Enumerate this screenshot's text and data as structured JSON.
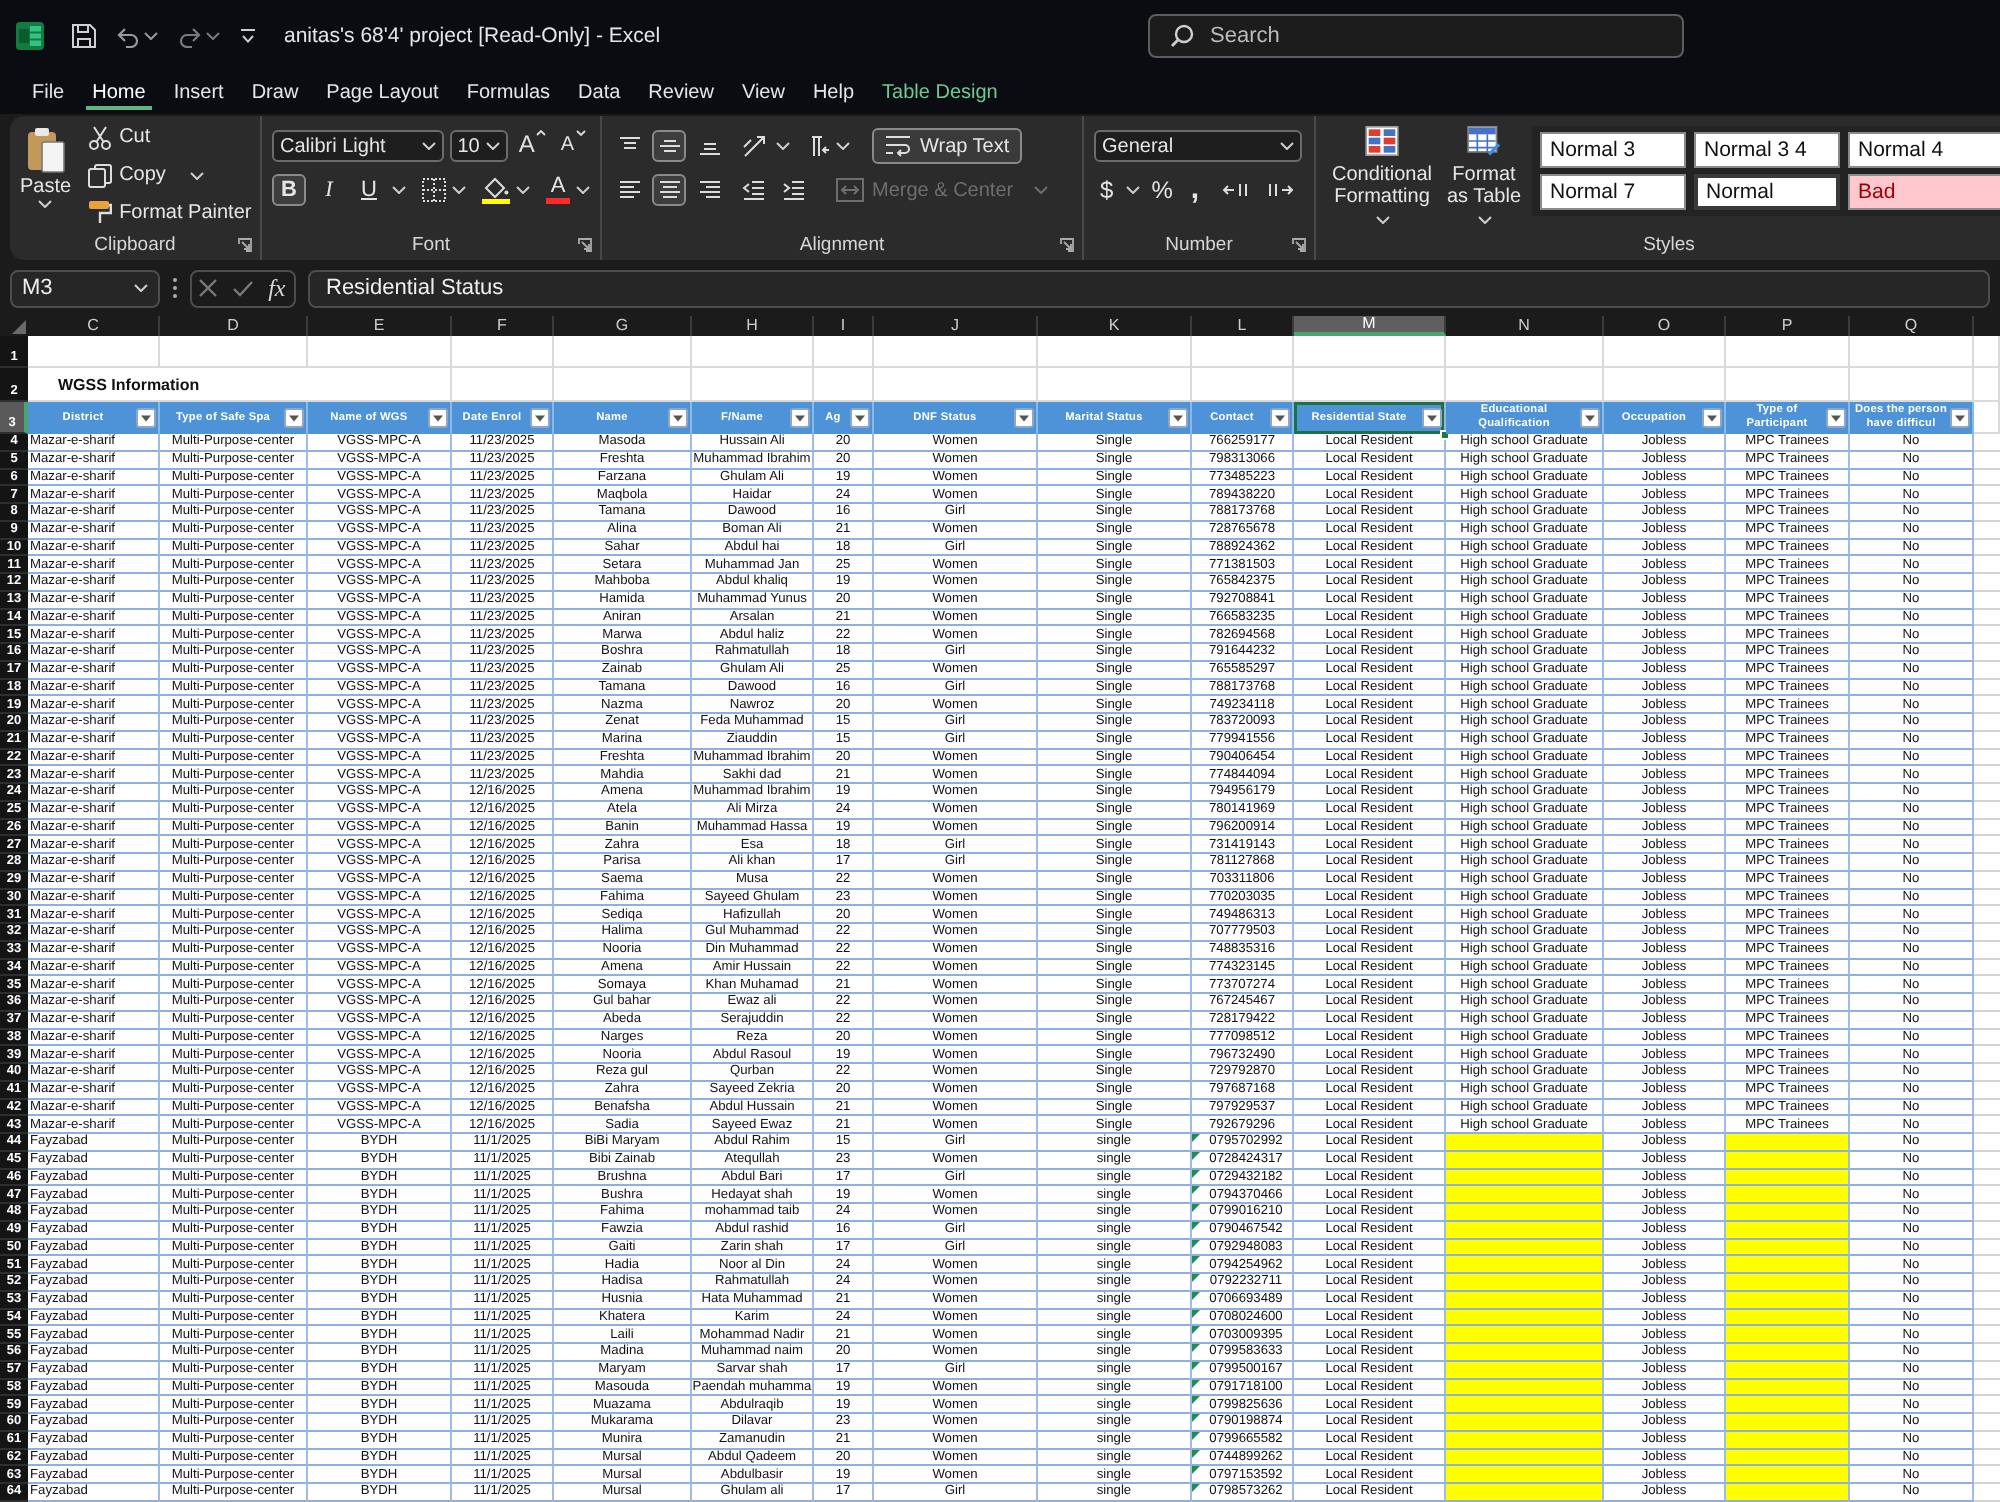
{
  "titlebar": {
    "title": "anitas's 68'4' project [Read-Only] - Excel",
    "search": {
      "placeholder": "Search"
    }
  },
  "menu_tabs": [
    {
      "label": "File",
      "selected": false,
      "kind": "standard"
    },
    {
      "label": "Home",
      "selected": true,
      "kind": "standard"
    },
    {
      "label": "Insert",
      "selected": false,
      "kind": "standard"
    },
    {
      "label": "Draw",
      "selected": false,
      "kind": "standard"
    },
    {
      "label": "Page Layout",
      "selected": false,
      "kind": "standard"
    },
    {
      "label": "Formulas",
      "selected": false,
      "kind": "standard"
    },
    {
      "label": "Data",
      "selected": false,
      "kind": "standard"
    },
    {
      "label": "Review",
      "selected": false,
      "kind": "standard"
    },
    {
      "label": "View",
      "selected": false,
      "kind": "standard"
    },
    {
      "label": "Help",
      "selected": false,
      "kind": "standard"
    },
    {
      "label": "Table Design",
      "selected": false,
      "kind": "contextual"
    }
  ],
  "ribbon": {
    "clipboard": {
      "label": "Clipboard",
      "paste": "Paste",
      "cut": "Cut",
      "copy": "Copy",
      "format_painter": "Format Painter"
    },
    "font": {
      "label": "Font",
      "font_name": "Calibri Light",
      "font_size": "10",
      "grow_font": "A",
      "shrink_font": "A",
      "bold": {
        "label": "B",
        "on": true
      },
      "italic": {
        "label": "I",
        "on": false
      },
      "underline": {
        "label": "U",
        "on": false
      },
      "font_color": "A"
    },
    "alignment": {
      "label": "Alignment",
      "vertical": [
        {
          "selected": false
        },
        {
          "selected": true
        },
        {
          "selected": false
        }
      ],
      "horizontal": [
        {
          "selected": false
        },
        {
          "selected": true
        },
        {
          "selected": false
        }
      ],
      "wrap_text": {
        "label": "Wrap Text",
        "on": true
      },
      "merge_center": {
        "label": "Merge & Center",
        "disabled": true
      }
    },
    "number": {
      "label": "Number",
      "format": "General",
      "currency": "$",
      "percent": "%",
      "comma": ","
    },
    "styles": {
      "label": "Styles",
      "conditional_formatting": "Conditional Formatting",
      "format_as_table": "Format as Table",
      "cell_styles": [
        {
          "label": "Normal 3",
          "kind": "normal",
          "selected": false
        },
        {
          "label": "Normal 3 4",
          "kind": "normal",
          "selected": false
        },
        {
          "label": "Normal 4",
          "kind": "normal",
          "selected": false
        },
        {
          "label": "Normal 7",
          "kind": "normal",
          "selected": false
        },
        {
          "label": "Normal",
          "kind": "normal",
          "selected": true
        },
        {
          "label": "Bad",
          "kind": "bad",
          "selected": false
        }
      ]
    }
  },
  "formula_bar": {
    "name_box": "M3",
    "function_button": "fx",
    "content": "Residential Status"
  },
  "sheet": {
    "columns": [
      {
        "letter": "C",
        "selected": false
      },
      {
        "letter": "D",
        "selected": false
      },
      {
        "letter": "E",
        "selected": false
      },
      {
        "letter": "F",
        "selected": false
      },
      {
        "letter": "G",
        "selected": false
      },
      {
        "letter": "H",
        "selected": false
      },
      {
        "letter": "I",
        "selected": false
      },
      {
        "letter": "J",
        "selected": false
      },
      {
        "letter": "K",
        "selected": false
      },
      {
        "letter": "L",
        "selected": false
      },
      {
        "letter": "M",
        "selected": true
      },
      {
        "letter": "N",
        "selected": false
      },
      {
        "letter": "O",
        "selected": false
      },
      {
        "letter": "P",
        "selected": false
      },
      {
        "letter": "Q",
        "selected": false
      }
    ],
    "first_row": {
      "number": "1",
      "selected": false
    },
    "title_row": {
      "number": "2",
      "selected": false,
      "title": "WGSS Information"
    },
    "header_row": {
      "number": "3",
      "selected": true,
      "cells": [
        "District",
        "Type of Safe Spa",
        "Name of WGS",
        "Date Enrol",
        "Name",
        "F/Name",
        "Ag",
        "DNF Status",
        "Marital Status",
        "Contact",
        "Residential State",
        "Educational Qualification",
        "Occupation",
        "Type of Participant",
        "Does the person have difficul"
      ]
    },
    "rows": [
      {
        "number": "4",
        "selected": false,
        "number_stored_as_text": false,
        "cells": [
          "Mazar-e-sharif",
          "Multi-Purpose-center",
          "VGSS-MPC-A",
          "11/23/2025",
          "Masoda",
          "Hussain Ali",
          "20",
          "Women",
          "Single",
          "766259177",
          "Local Resident",
          "High school Graduate",
          "Jobless",
          "MPC Trainees",
          "No"
        ]
      },
      {
        "number": "5",
        "selected": false,
        "number_stored_as_text": false,
        "cells": [
          "Mazar-e-sharif",
          "Multi-Purpose-center",
          "VGSS-MPC-A",
          "11/23/2025",
          "Freshta",
          "Muhammad Ibrahim",
          "20",
          "Women",
          "Single",
          "798313066",
          "Local Resident",
          "High school Graduate",
          "Jobless",
          "MPC Trainees",
          "No"
        ]
      },
      {
        "number": "6",
        "selected": false,
        "number_stored_as_text": false,
        "cells": [
          "Mazar-e-sharif",
          "Multi-Purpose-center",
          "VGSS-MPC-A",
          "11/23/2025",
          "Farzana",
          "Ghulam Ali",
          "19",
          "Women",
          "Single",
          "773485223",
          "Local Resident",
          "High school Graduate",
          "Jobless",
          "MPC Trainees",
          "No"
        ]
      },
      {
        "number": "7",
        "selected": false,
        "number_stored_as_text": false,
        "cells": [
          "Mazar-e-sharif",
          "Multi-Purpose-center",
          "VGSS-MPC-A",
          "11/23/2025",
          "Maqbola",
          "Haidar",
          "24",
          "Women",
          "Single",
          "789438220",
          "Local Resident",
          "High school Graduate",
          "Jobless",
          "MPC Trainees",
          "No"
        ]
      },
      {
        "number": "8",
        "selected": false,
        "number_stored_as_text": false,
        "cells": [
          "Mazar-e-sharif",
          "Multi-Purpose-center",
          "VGSS-MPC-A",
          "11/23/2025",
          "Tamana",
          "Dawood",
          "16",
          "Girl",
          "Single",
          "788173768",
          "Local Resident",
          "High school Graduate",
          "Jobless",
          "MPC Trainees",
          "No"
        ]
      },
      {
        "number": "9",
        "selected": false,
        "number_stored_as_text": false,
        "cells": [
          "Mazar-e-sharif",
          "Multi-Purpose-center",
          "VGSS-MPC-A",
          "11/23/2025",
          "Alina",
          "Boman Ali",
          "21",
          "Women",
          "Single",
          "728765678",
          "Local Resident",
          "High school Graduate",
          "Jobless",
          "MPC Trainees",
          "No"
        ]
      },
      {
        "number": "10",
        "selected": false,
        "number_stored_as_text": false,
        "cells": [
          "Mazar-e-sharif",
          "Multi-Purpose-center",
          "VGSS-MPC-A",
          "11/23/2025",
          "Sahar",
          "Abdul hai",
          "18",
          "Girl",
          "Single",
          "788924362",
          "Local Resident",
          "High school Graduate",
          "Jobless",
          "MPC Trainees",
          "No"
        ]
      },
      {
        "number": "11",
        "selected": false,
        "number_stored_as_text": false,
        "cells": [
          "Mazar-e-sharif",
          "Multi-Purpose-center",
          "VGSS-MPC-A",
          "11/23/2025",
          "Setara",
          "Muhammad Jan",
          "25",
          "Women",
          "Single",
          "771381503",
          "Local Resident",
          "High school Graduate",
          "Jobless",
          "MPC Trainees",
          "No"
        ]
      },
      {
        "number": "12",
        "selected": false,
        "number_stored_as_text": false,
        "cells": [
          "Mazar-e-sharif",
          "Multi-Purpose-center",
          "VGSS-MPC-A",
          "11/23/2025",
          "Mahboba",
          "Abdul khaliq",
          "19",
          "Women",
          "Single",
          "765842375",
          "Local Resident",
          "High school Graduate",
          "Jobless",
          "MPC Trainees",
          "No"
        ]
      },
      {
        "number": "13",
        "selected": false,
        "number_stored_as_text": false,
        "cells": [
          "Mazar-e-sharif",
          "Multi-Purpose-center",
          "VGSS-MPC-A",
          "11/23/2025",
          "Hamida",
          "Muhammad Yunus",
          "20",
          "Women",
          "Single",
          "792708841",
          "Local Resident",
          "High school Graduate",
          "Jobless",
          "MPC Trainees",
          "No"
        ]
      },
      {
        "number": "14",
        "selected": false,
        "number_stored_as_text": false,
        "cells": [
          "Mazar-e-sharif",
          "Multi-Purpose-center",
          "VGSS-MPC-A",
          "11/23/2025",
          "Aniran",
          "Arsalan",
          "21",
          "Women",
          "Single",
          "766583235",
          "Local Resident",
          "High school Graduate",
          "Jobless",
          "MPC Trainees",
          "No"
        ]
      },
      {
        "number": "15",
        "selected": false,
        "number_stored_as_text": false,
        "cells": [
          "Mazar-e-sharif",
          "Multi-Purpose-center",
          "VGSS-MPC-A",
          "11/23/2025",
          "Marwa",
          "Abdul haliz",
          "22",
          "Women",
          "Single",
          "782694568",
          "Local Resident",
          "High school Graduate",
          "Jobless",
          "MPC Trainees",
          "No"
        ]
      },
      {
        "number": "16",
        "selected": false,
        "number_stored_as_text": false,
        "cells": [
          "Mazar-e-sharif",
          "Multi-Purpose-center",
          "VGSS-MPC-A",
          "11/23/2025",
          "Boshra",
          "Rahmatullah",
          "18",
          "Girl",
          "Single",
          "791644232",
          "Local Resident",
          "High school Graduate",
          "Jobless",
          "MPC Trainees",
          "No"
        ]
      },
      {
        "number": "17",
        "selected": false,
        "number_stored_as_text": false,
        "cells": [
          "Mazar-e-sharif",
          "Multi-Purpose-center",
          "VGSS-MPC-A",
          "11/23/2025",
          "Zainab",
          "Ghulam Ali",
          "25",
          "Women",
          "Single",
          "765585297",
          "Local Resident",
          "High school Graduate",
          "Jobless",
          "MPC Trainees",
          "No"
        ]
      },
      {
        "number": "18",
        "selected": false,
        "number_stored_as_text": false,
        "cells": [
          "Mazar-e-sharif",
          "Multi-Purpose-center",
          "VGSS-MPC-A",
          "11/23/2025",
          "Tamana",
          "Dawood",
          "16",
          "Girl",
          "Single",
          "788173768",
          "Local Resident",
          "High school Graduate",
          "Jobless",
          "MPC Trainees",
          "No"
        ]
      },
      {
        "number": "19",
        "selected": false,
        "number_stored_as_text": false,
        "cells": [
          "Mazar-e-sharif",
          "Multi-Purpose-center",
          "VGSS-MPC-A",
          "11/23/2025",
          "Nazma",
          "Nawroz",
          "20",
          "Women",
          "Single",
          "749234118",
          "Local Resident",
          "High school Graduate",
          "Jobless",
          "MPC Trainees",
          "No"
        ]
      },
      {
        "number": "20",
        "selected": false,
        "number_stored_as_text": false,
        "cells": [
          "Mazar-e-sharif",
          "Multi-Purpose-center",
          "VGSS-MPC-A",
          "11/23/2025",
          "Zenat",
          "Feda Muhammad",
          "15",
          "Girl",
          "Single",
          "783720093",
          "Local Resident",
          "High school Graduate",
          "Jobless",
          "MPC Trainees",
          "No"
        ]
      },
      {
        "number": "21",
        "selected": false,
        "number_stored_as_text": false,
        "cells": [
          "Mazar-e-sharif",
          "Multi-Purpose-center",
          "VGSS-MPC-A",
          "11/23/2025",
          "Marina",
          "Ziauddin",
          "15",
          "Girl",
          "Single",
          "779941556",
          "Local Resident",
          "High school Graduate",
          "Jobless",
          "MPC Trainees",
          "No"
        ]
      },
      {
        "number": "22",
        "selected": false,
        "number_stored_as_text": false,
        "cells": [
          "Mazar-e-sharif",
          "Multi-Purpose-center",
          "VGSS-MPC-A",
          "11/23/2025",
          "Freshta",
          "Muhammad Ibrahim",
          "20",
          "Women",
          "Single",
          "790406454",
          "Local Resident",
          "High school Graduate",
          "Jobless",
          "MPC Trainees",
          "No"
        ]
      },
      {
        "number": "23",
        "selected": false,
        "number_stored_as_text": false,
        "cells": [
          "Mazar-e-sharif",
          "Multi-Purpose-center",
          "VGSS-MPC-A",
          "11/23/2025",
          "Mahdia",
          "Sakhi dad",
          "21",
          "Women",
          "Single",
          "774844094",
          "Local Resident",
          "High school Graduate",
          "Jobless",
          "MPC Trainees",
          "No"
        ]
      },
      {
        "number": "24",
        "selected": false,
        "number_stored_as_text": false,
        "cells": [
          "Mazar-e-sharif",
          "Multi-Purpose-center",
          "VGSS-MPC-A",
          "12/16/2025",
          "Amena",
          "Muhammad Ibrahim",
          "19",
          "Women",
          "Single",
          "794956179",
          "Local Resident",
          "High school Graduate",
          "Jobless",
          "MPC Trainees",
          "No"
        ]
      },
      {
        "number": "25",
        "selected": false,
        "number_stored_as_text": false,
        "cells": [
          "Mazar-e-sharif",
          "Multi-Purpose-center",
          "VGSS-MPC-A",
          "12/16/2025",
          "Atela",
          "Ali Mirza",
          "24",
          "Women",
          "Single",
          "780141969",
          "Local Resident",
          "High school Graduate",
          "Jobless",
          "MPC Trainees",
          "No"
        ]
      },
      {
        "number": "26",
        "selected": false,
        "number_stored_as_text": false,
        "cells": [
          "Mazar-e-sharif",
          "Multi-Purpose-center",
          "VGSS-MPC-A",
          "12/16/2025",
          "Banin",
          "Muhammad Hassa",
          "19",
          "Women",
          "Single",
          "796200914",
          "Local Resident",
          "High school Graduate",
          "Jobless",
          "MPC Trainees",
          "No"
        ]
      },
      {
        "number": "27",
        "selected": false,
        "number_stored_as_text": false,
        "cells": [
          "Mazar-e-sharif",
          "Multi-Purpose-center",
          "VGSS-MPC-A",
          "12/16/2025",
          "Zahra",
          "Esa",
          "18",
          "Girl",
          "Single",
          "731419143",
          "Local Resident",
          "High school Graduate",
          "Jobless",
          "MPC Trainees",
          "No"
        ]
      },
      {
        "number": "28",
        "selected": false,
        "number_stored_as_text": false,
        "cells": [
          "Mazar-e-sharif",
          "Multi-Purpose-center",
          "VGSS-MPC-A",
          "12/16/2025",
          "Parisa",
          "Ali khan",
          "17",
          "Girl",
          "Single",
          "781127868",
          "Local Resident",
          "High school Graduate",
          "Jobless",
          "MPC Trainees",
          "No"
        ]
      },
      {
        "number": "29",
        "selected": false,
        "number_stored_as_text": false,
        "cells": [
          "Mazar-e-sharif",
          "Multi-Purpose-center",
          "VGSS-MPC-A",
          "12/16/2025",
          "Saema",
          "Musa",
          "22",
          "Women",
          "Single",
          "703311806",
          "Local Resident",
          "High school Graduate",
          "Jobless",
          "MPC Trainees",
          "No"
        ]
      },
      {
        "number": "30",
        "selected": false,
        "number_stored_as_text": false,
        "cells": [
          "Mazar-e-sharif",
          "Multi-Purpose-center",
          "VGSS-MPC-A",
          "12/16/2025",
          "Fahima",
          "Sayeed Ghulam",
          "23",
          "Women",
          "Single",
          "770203035",
          "Local Resident",
          "High school Graduate",
          "Jobless",
          "MPC Trainees",
          "No"
        ]
      },
      {
        "number": "31",
        "selected": false,
        "number_stored_as_text": false,
        "cells": [
          "Mazar-e-sharif",
          "Multi-Purpose-center",
          "VGSS-MPC-A",
          "12/16/2025",
          "Sediqa",
          "Hafizullah",
          "20",
          "Women",
          "Single",
          "749486313",
          "Local Resident",
          "High school Graduate",
          "Jobless",
          "MPC Trainees",
          "No"
        ]
      },
      {
        "number": "32",
        "selected": false,
        "number_stored_as_text": false,
        "cells": [
          "Mazar-e-sharif",
          "Multi-Purpose-center",
          "VGSS-MPC-A",
          "12/16/2025",
          "Halima",
          "Gul Muhammad",
          "22",
          "Women",
          "Single",
          "707779503",
          "Local Resident",
          "High school Graduate",
          "Jobless",
          "MPC Trainees",
          "No"
        ]
      },
      {
        "number": "33",
        "selected": false,
        "number_stored_as_text": false,
        "cells": [
          "Mazar-e-sharif",
          "Multi-Purpose-center",
          "VGSS-MPC-A",
          "12/16/2025",
          "Nooria",
          "Din Muhammad",
          "22",
          "Women",
          "Single",
          "748835316",
          "Local Resident",
          "High school Graduate",
          "Jobless",
          "MPC Trainees",
          "No"
        ]
      },
      {
        "number": "34",
        "selected": false,
        "number_stored_as_text": false,
        "cells": [
          "Mazar-e-sharif",
          "Multi-Purpose-center",
          "VGSS-MPC-A",
          "12/16/2025",
          "Amena",
          "Amir Hussain",
          "22",
          "Women",
          "Single",
          "774323145",
          "Local Resident",
          "High school Graduate",
          "Jobless",
          "MPC Trainees",
          "No"
        ]
      },
      {
        "number": "35",
        "selected": false,
        "number_stored_as_text": false,
        "cells": [
          "Mazar-e-sharif",
          "Multi-Purpose-center",
          "VGSS-MPC-A",
          "12/16/2025",
          "Somaya",
          "Khan Muhamad",
          "21",
          "Women",
          "Single",
          "773707274",
          "Local Resident",
          "High school Graduate",
          "Jobless",
          "MPC Trainees",
          "No"
        ]
      },
      {
        "number": "36",
        "selected": false,
        "number_stored_as_text": false,
        "cells": [
          "Mazar-e-sharif",
          "Multi-Purpose-center",
          "VGSS-MPC-A",
          "12/16/2025",
          "Gul bahar",
          "Ewaz ali",
          "22",
          "Women",
          "Single",
          "767245467",
          "Local Resident",
          "High school Graduate",
          "Jobless",
          "MPC Trainees",
          "No"
        ]
      },
      {
        "number": "37",
        "selected": false,
        "number_stored_as_text": false,
        "cells": [
          "Mazar-e-sharif",
          "Multi-Purpose-center",
          "VGSS-MPC-A",
          "12/16/2025",
          "Abeda",
          "Serajuddin",
          "22",
          "Women",
          "Single",
          "728179422",
          "Local Resident",
          "High school Graduate",
          "Jobless",
          "MPC Trainees",
          "No"
        ]
      },
      {
        "number": "38",
        "selected": false,
        "number_stored_as_text": false,
        "cells": [
          "Mazar-e-sharif",
          "Multi-Purpose-center",
          "VGSS-MPC-A",
          "12/16/2025",
          "Narges",
          "Reza",
          "20",
          "Women",
          "Single",
          "777098512",
          "Local Resident",
          "High school Graduate",
          "Jobless",
          "MPC Trainees",
          "No"
        ]
      },
      {
        "number": "39",
        "selected": false,
        "number_stored_as_text": false,
        "cells": [
          "Mazar-e-sharif",
          "Multi-Purpose-center",
          "VGSS-MPC-A",
          "12/16/2025",
          "Nooria",
          "Abdul Rasoul",
          "19",
          "Women",
          "Single",
          "796732490",
          "Local Resident",
          "High school Graduate",
          "Jobless",
          "MPC Trainees",
          "No"
        ]
      },
      {
        "number": "40",
        "selected": false,
        "number_stored_as_text": false,
        "cells": [
          "Mazar-e-sharif",
          "Multi-Purpose-center",
          "VGSS-MPC-A",
          "12/16/2025",
          "Reza gul",
          "Qurban",
          "22",
          "Women",
          "Single",
          "729792870",
          "Local Resident",
          "High school Graduate",
          "Jobless",
          "MPC Trainees",
          "No"
        ]
      },
      {
        "number": "41",
        "selected": false,
        "number_stored_as_text": false,
        "cells": [
          "Mazar-e-sharif",
          "Multi-Purpose-center",
          "VGSS-MPC-A",
          "12/16/2025",
          "Zahra",
          "Sayeed Zekria",
          "20",
          "Women",
          "Single",
          "797687168",
          "Local Resident",
          "High school Graduate",
          "Jobless",
          "MPC Trainees",
          "No"
        ]
      },
      {
        "number": "42",
        "selected": false,
        "number_stored_as_text": false,
        "cells": [
          "Mazar-e-sharif",
          "Multi-Purpose-center",
          "VGSS-MPC-A",
          "12/16/2025",
          "Benafsha",
          "Abdul Hussain",
          "21",
          "Women",
          "Single",
          "797929537",
          "Local Resident",
          "High school Graduate",
          "Jobless",
          "MPC Trainees",
          "No"
        ]
      },
      {
        "number": "43",
        "selected": false,
        "number_stored_as_text": false,
        "cells": [
          "Mazar-e-sharif",
          "Multi-Purpose-center",
          "VGSS-MPC-A",
          "12/16/2025",
          "Sadia",
          "Sayeed Ewaz",
          "21",
          "Women",
          "Single",
          "792679296",
          "Local Resident",
          "High school Graduate",
          "Jobless",
          "MPC Trainees",
          "No"
        ]
      },
      {
        "number": "44",
        "selected": false,
        "number_stored_as_text": true,
        "cells": [
          "Fayzabad",
          "Multi-Purpose-center",
          "BYDH",
          "11/1/2025",
          "BiBi Maryam",
          "Abdul Rahim",
          "15",
          "Girl",
          "single",
          "0795702992",
          "Local Resident",
          {
            "highlight": true
          },
          "Jobless",
          {
            "highlight": true
          },
          "No"
        ]
      },
      {
        "number": "45",
        "selected": false,
        "number_stored_as_text": true,
        "cells": [
          "Fayzabad",
          "Multi-Purpose-center",
          "BYDH",
          "11/1/2025",
          "Bibi Zainab",
          "Atequllah",
          "23",
          "Women",
          "single",
          "0728424317",
          "Local Resident",
          {
            "highlight": true
          },
          "Jobless",
          {
            "highlight": true
          },
          "No"
        ]
      },
      {
        "number": "46",
        "selected": false,
        "number_stored_as_text": true,
        "cells": [
          "Fayzabad",
          "Multi-Purpose-center",
          "BYDH",
          "11/1/2025",
          "Brushna",
          "Abdul Bari",
          "17",
          "Girl",
          "single",
          "0729432182",
          "Local Resident",
          {
            "highlight": true
          },
          "Jobless",
          {
            "highlight": true
          },
          "No"
        ]
      },
      {
        "number": "47",
        "selected": false,
        "number_stored_as_text": true,
        "cells": [
          "Fayzabad",
          "Multi-Purpose-center",
          "BYDH",
          "11/1/2025",
          "Bushra",
          "Hedayat shah",
          "19",
          "Women",
          "single",
          "0794370466",
          "Local Resident",
          {
            "highlight": true
          },
          "Jobless",
          {
            "highlight": true
          },
          "No"
        ]
      },
      {
        "number": "48",
        "selected": false,
        "number_stored_as_text": true,
        "cells": [
          "Fayzabad",
          "Multi-Purpose-center",
          "BYDH",
          "11/1/2025",
          "Fahima",
          "mohammad taib",
          "24",
          "Women",
          "single",
          "0799016210",
          "Local Resident",
          {
            "highlight": true
          },
          "Jobless",
          {
            "highlight": true
          },
          "No"
        ]
      },
      {
        "number": "49",
        "selected": false,
        "number_stored_as_text": true,
        "cells": [
          "Fayzabad",
          "Multi-Purpose-center",
          "BYDH",
          "11/1/2025",
          "Fawzia",
          "Abdul rashid",
          "16",
          "Girl",
          "single",
          "0790467542",
          "Local Resident",
          {
            "highlight": true
          },
          "Jobless",
          {
            "highlight": true
          },
          "No"
        ]
      },
      {
        "number": "50",
        "selected": false,
        "number_stored_as_text": true,
        "cells": [
          "Fayzabad",
          "Multi-Purpose-center",
          "BYDH",
          "11/1/2025",
          "Gaiti",
          "Zarin shah",
          "17",
          "Girl",
          "single",
          "0792948083",
          "Local Resident",
          {
            "highlight": true
          },
          "Jobless",
          {
            "highlight": true
          },
          "No"
        ]
      },
      {
        "number": "51",
        "selected": false,
        "number_stored_as_text": true,
        "cells": [
          "Fayzabad",
          "Multi-Purpose-center",
          "BYDH",
          "11/1/2025",
          "Hadia",
          "Noor al Din",
          "24",
          "Women",
          "single",
          "0794254962",
          "Local Resident",
          {
            "highlight": true
          },
          "Jobless",
          {
            "highlight": true
          },
          "No"
        ]
      },
      {
        "number": "52",
        "selected": false,
        "number_stored_as_text": true,
        "cells": [
          "Fayzabad",
          "Multi-Purpose-center",
          "BYDH",
          "11/1/2025",
          "Hadisa",
          "Rahmatullah",
          "24",
          "Women",
          "single",
          "0792232711",
          "Local Resident",
          {
            "highlight": true
          },
          "Jobless",
          {
            "highlight": true
          },
          "No"
        ]
      },
      {
        "number": "53",
        "selected": false,
        "number_stored_as_text": true,
        "cells": [
          "Fayzabad",
          "Multi-Purpose-center",
          "BYDH",
          "11/1/2025",
          "Husnia",
          "Hata Muhammad",
          "21",
          "Women",
          "single",
          "0706693489",
          "Local Resident",
          {
            "highlight": true
          },
          "Jobless",
          {
            "highlight": true
          },
          "No"
        ]
      },
      {
        "number": "54",
        "selected": false,
        "number_stored_as_text": true,
        "cells": [
          "Fayzabad",
          "Multi-Purpose-center",
          "BYDH",
          "11/1/2025",
          "Khatera",
          "Karim",
          "24",
          "Women",
          "single",
          "0708024600",
          "Local Resident",
          {
            "highlight": true
          },
          "Jobless",
          {
            "highlight": true
          },
          "No"
        ]
      },
      {
        "number": "55",
        "selected": false,
        "number_stored_as_text": true,
        "cells": [
          "Fayzabad",
          "Multi-Purpose-center",
          "BYDH",
          "11/1/2025",
          "Laili",
          "Mohammad Nadir",
          "21",
          "Women",
          "single",
          "0703009395",
          "Local Resident",
          {
            "highlight": true
          },
          "Jobless",
          {
            "highlight": true
          },
          "No"
        ]
      },
      {
        "number": "56",
        "selected": false,
        "number_stored_as_text": true,
        "cells": [
          "Fayzabad",
          "Multi-Purpose-center",
          "BYDH",
          "11/1/2025",
          "Madina",
          "Muhammad naim",
          "20",
          "Women",
          "single",
          "0799583633",
          "Local Resident",
          {
            "highlight": true
          },
          "Jobless",
          {
            "highlight": true
          },
          "No"
        ]
      },
      {
        "number": "57",
        "selected": false,
        "number_stored_as_text": true,
        "cells": [
          "Fayzabad",
          "Multi-Purpose-center",
          "BYDH",
          "11/1/2025",
          "Maryam",
          "Sarvar shah",
          "17",
          "Girl",
          "single",
          "0799500167",
          "Local Resident",
          {
            "highlight": true
          },
          "Jobless",
          {
            "highlight": true
          },
          "No"
        ]
      },
      {
        "number": "58",
        "selected": false,
        "number_stored_as_text": true,
        "cells": [
          "Fayzabad",
          "Multi-Purpose-center",
          "BYDH",
          "11/1/2025",
          "Masouda",
          "Paendah muhamma",
          "19",
          "Women",
          "single",
          "0791718100",
          "Local Resident",
          {
            "highlight": true
          },
          "Jobless",
          {
            "highlight": true
          },
          "No"
        ]
      },
      {
        "number": "59",
        "selected": false,
        "number_stored_as_text": true,
        "cells": [
          "Fayzabad",
          "Multi-Purpose-center",
          "BYDH",
          "11/1/2025",
          "Muazama",
          "Abdulraqib",
          "19",
          "Women",
          "single",
          "0799825636",
          "Local Resident",
          {
            "highlight": true
          },
          "Jobless",
          {
            "highlight": true
          },
          "No"
        ]
      },
      {
        "number": "60",
        "selected": false,
        "number_stored_as_text": true,
        "cells": [
          "Fayzabad",
          "Multi-Purpose-center",
          "BYDH",
          "11/1/2025",
          "Mukarama",
          "Dilavar",
          "23",
          "Women",
          "single",
          "0790198874",
          "Local Resident",
          {
            "highlight": true
          },
          "Jobless",
          {
            "highlight": true
          },
          "No"
        ]
      },
      {
        "number": "61",
        "selected": false,
        "number_stored_as_text": true,
        "cells": [
          "Fayzabad",
          "Multi-Purpose-center",
          "BYDH",
          "11/1/2025",
          "Munira",
          "Zamanudin",
          "21",
          "Women",
          "single",
          "0799665582",
          "Local Resident",
          {
            "highlight": true
          },
          "Jobless",
          {
            "highlight": true
          },
          "No"
        ]
      },
      {
        "number": "62",
        "selected": false,
        "number_stored_as_text": true,
        "cells": [
          "Fayzabad",
          "Multi-Purpose-center",
          "BYDH",
          "11/1/2025",
          "Mursal",
          "Abdul Qadeem",
          "20",
          "Women",
          "single",
          "0744899262",
          "Local Resident",
          {
            "highlight": true
          },
          "Jobless",
          {
            "highlight": true
          },
          "No"
        ]
      },
      {
        "number": "63",
        "selected": false,
        "number_stored_as_text": true,
        "cells": [
          "Fayzabad",
          "Multi-Purpose-center",
          "BYDH",
          "11/1/2025",
          "Mursal",
          "Abdulbasir",
          "19",
          "Women",
          "single",
          "0797153592",
          "Local Resident",
          {
            "highlight": true
          },
          "Jobless",
          {
            "highlight": true
          },
          "No"
        ]
      },
      {
        "number": "64",
        "selected": false,
        "number_stored_as_text": true,
        "cells": [
          "Fayzabad",
          "Multi-Purpose-center",
          "BYDH",
          "11/1/2025",
          "Mursal",
          "Ghulam ali",
          "17",
          "Girl",
          "single",
          "0798573262",
          "Local Resident",
          {
            "highlight": true
          },
          "Jobless",
          {
            "highlight": true
          },
          "No"
        ]
      }
    ]
  }
}
